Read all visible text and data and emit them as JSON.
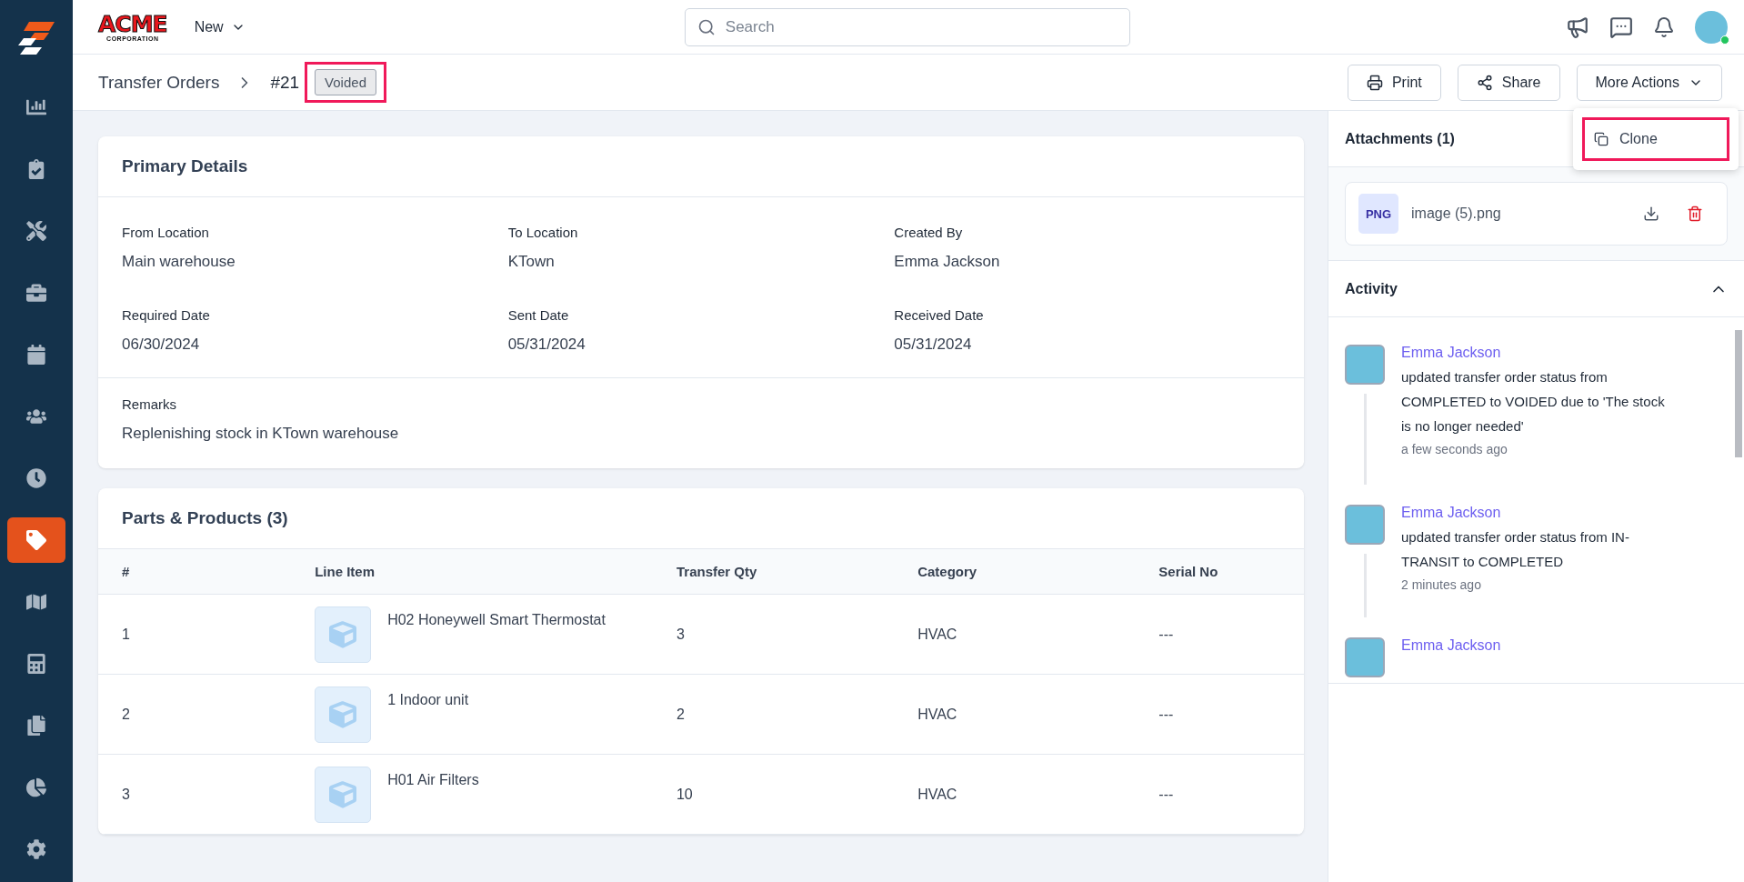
{
  "sidebar": {
    "items": [
      {
        "selected": false
      },
      {
        "selected": false
      },
      {
        "selected": false
      },
      {
        "selected": false
      },
      {
        "selected": false
      },
      {
        "selected": false
      },
      {
        "selected": false
      },
      {
        "selected": true
      },
      {
        "selected": false
      },
      {
        "selected": false
      },
      {
        "selected": false
      },
      {
        "selected": false
      },
      {
        "selected": false
      }
    ]
  },
  "header": {
    "logo_top": "ACME",
    "logo_bottom": "CORPORATION",
    "new_menu": "New",
    "search": {
      "placeholder": "Search"
    },
    "user_online": true
  },
  "breadcrumb": {
    "parent": "Transfer Orders",
    "current": "#21",
    "status": {
      "label": "Voided",
      "highlighted": true
    }
  },
  "actions": {
    "buttons": [
      {
        "kind": "print",
        "label": "Print"
      },
      {
        "kind": "share",
        "label": "Share"
      }
    ],
    "more": {
      "label": "More Actions",
      "expanded": true,
      "items": [
        {
          "label": "Clone",
          "highlighted": true
        }
      ]
    }
  },
  "primary_details": {
    "title": "Primary Details",
    "fields": [
      {
        "label": "From Location",
        "value": "Main warehouse"
      },
      {
        "label": "To Location",
        "value": "KTown"
      },
      {
        "label": "Created By",
        "value": "Emma Jackson"
      },
      {
        "label": "Required Date",
        "value": "06/30/2024"
      },
      {
        "label": "Sent Date",
        "value": "05/31/2024"
      },
      {
        "label": "Received Date",
        "value": "05/31/2024"
      }
    ],
    "remarks": {
      "label": "Remarks",
      "value": "Replenishing stock in KTown warehouse"
    }
  },
  "parts": {
    "title": "Parts & Products (3)",
    "columns": [
      "#",
      "Line Item",
      "Transfer Qty",
      "Category",
      "Serial No"
    ],
    "rows": [
      {
        "index": "1",
        "item": "H02 Honeywell Smart Thermostat",
        "qty": "3",
        "category": "HVAC",
        "serial": "---"
      },
      {
        "index": "2",
        "item": "1 Indoor unit",
        "qty": "2",
        "category": "HVAC",
        "serial": "---"
      },
      {
        "index": "3",
        "item": "H01 Air Filters",
        "qty": "10",
        "category": "HVAC",
        "serial": "---"
      }
    ]
  },
  "attachments": {
    "title": "Attachments (1)",
    "files": [
      {
        "type": "PNG",
        "name": "image (5).png"
      }
    ]
  },
  "activity": {
    "title": "Activity",
    "expanded": true,
    "entries": [
      {
        "user": "Emma Jackson",
        "text": "updated transfer order status from COMPLETED to VOIDED due to 'The stock is no longer needed'",
        "time": "a few seconds ago"
      },
      {
        "user": "Emma Jackson",
        "text": "updated transfer order status from IN-TRANSIT to COMPLETED",
        "time": "2 minutes ago"
      },
      {
        "user": "Emma Jackson"
      }
    ]
  }
}
